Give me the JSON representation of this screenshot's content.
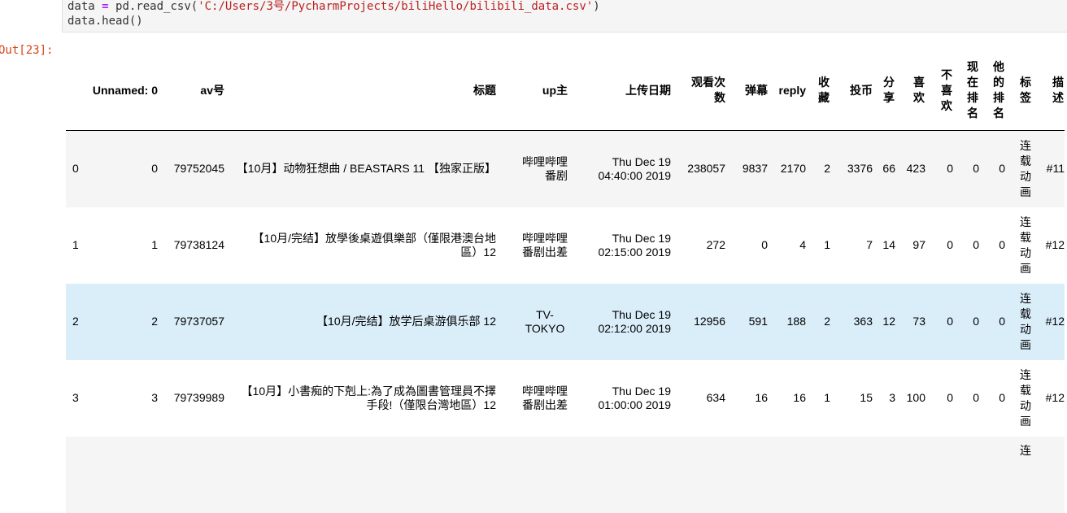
{
  "code": {
    "line1_var": "data",
    "line1_op": "=",
    "line1_call": "pd.read_csv(",
    "line1_str": "'C:/Users/3号/PycharmProjects/biliHello/bilibili_data.csv'",
    "line1_close": ")",
    "line2": "data.head()"
  },
  "prompt": "Out[23]:",
  "table": {
    "headers": {
      "unnamed": "Unnamed: 0",
      "av": "av号",
      "title": "标题",
      "up": "up主",
      "date": "上传日期",
      "views": "观看次数",
      "danmu": "弹幕",
      "reply": "reply",
      "fav": "收藏",
      "coin": "投币",
      "share": "分享",
      "like": "喜欢",
      "dislike": "不喜欢",
      "now_rank": "现在排名",
      "his_rank": "他的排名",
      "tag": "标签",
      "desc": "描述"
    },
    "rows": [
      {
        "idx": "0",
        "unnamed": "0",
        "av": "79752045",
        "title": "【10月】动物狂想曲 / BEASTARS 11 【独家正版】",
        "up": "哔哩哔哩番剧",
        "date1": "Thu Dec 19",
        "date2": "04:40:00 2019",
        "views": "238057",
        "danmu": "9837",
        "reply": "2170",
        "fav": "2",
        "coin": "3376",
        "share": "66",
        "like": "423",
        "dislike": "0",
        "now_rank": "0",
        "his_rank": "0",
        "tag": "连载动画",
        "desc": "#11"
      },
      {
        "idx": "1",
        "unnamed": "1",
        "av": "79738124",
        "title": "【10月/完结】放學後桌遊俱樂部（僅限港澳台地區）12",
        "up": "哔哩哔哩番剧出差",
        "date1": "Thu Dec 19",
        "date2": "02:15:00 2019",
        "views": "272",
        "danmu": "0",
        "reply": "4",
        "fav": "1",
        "coin": "7",
        "share": "14",
        "like": "97",
        "dislike": "0",
        "now_rank": "0",
        "his_rank": "0",
        "tag": "连载动画",
        "desc": "#12"
      },
      {
        "idx": "2",
        "unnamed": "2",
        "av": "79737057",
        "title": "【10月/完结】放学后桌游俱乐部 12",
        "up": "TV-TOKYO",
        "date1": "Thu Dec 19",
        "date2": "02:12:00 2019",
        "views": "12956",
        "danmu": "591",
        "reply": "188",
        "fav": "2",
        "coin": "363",
        "share": "12",
        "like": "73",
        "dislike": "0",
        "now_rank": "0",
        "his_rank": "0",
        "tag": "连载动画",
        "desc": "#12"
      },
      {
        "idx": "3",
        "unnamed": "3",
        "av": "79739989",
        "title": "【10月】小書痴的下剋上:為了成為圖書管理員不擇手段!（僅限台灣地區）12",
        "up": "哔哩哔哩番剧出差",
        "date1": "Thu Dec 19",
        "date2": "01:00:00 2019",
        "views": "634",
        "danmu": "16",
        "reply": "16",
        "fav": "1",
        "coin": "15",
        "share": "3",
        "like": "100",
        "dislike": "0",
        "now_rank": "0",
        "his_rank": "0",
        "tag": "连载动画",
        "desc": "#12"
      },
      {
        "idx": "",
        "unnamed": "",
        "av": "",
        "title": "",
        "up": "",
        "date1": "",
        "date2": "",
        "views": "",
        "danmu": "",
        "reply": "",
        "fav": "",
        "coin": "",
        "share": "",
        "like": "",
        "dislike": "",
        "now_rank": "",
        "his_rank": "",
        "tag": "连",
        "desc": ""
      }
    ]
  },
  "colors": {
    "code_bg": "#f5f5f5",
    "prompt": "#d84315",
    "row_alt": "#f5f5f5",
    "row_hover": "#daeefa"
  }
}
